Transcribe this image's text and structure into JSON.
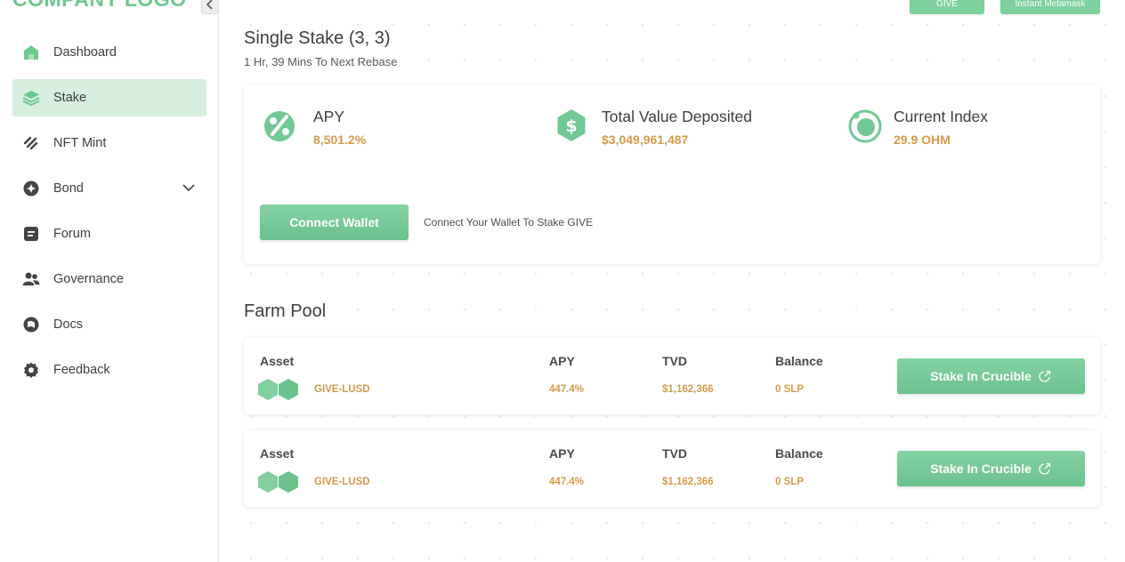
{
  "sidebar": {
    "logo": "COMPANY LOGO",
    "items": [
      {
        "label": "Dashboard",
        "icon": "home-icon"
      },
      {
        "label": "Stake",
        "icon": "layers-icon",
        "active": true
      },
      {
        "label": "NFT Mint",
        "icon": "nft-icon"
      },
      {
        "label": "Bond",
        "icon": "bond-icon",
        "has_submenu": true
      },
      {
        "label": "Forum",
        "icon": "forum-icon"
      },
      {
        "label": "Governance",
        "icon": "users-icon"
      },
      {
        "label": "Docs",
        "icon": "docs-icon"
      },
      {
        "label": "Feedback",
        "icon": "gear-icon"
      }
    ]
  },
  "header": {
    "buttons": [
      "GIVE",
      "Instant Metamask"
    ]
  },
  "single_stake": {
    "title": "Single Stake (3, 3)",
    "subtitle": "1 Hr, 39 Mins To Next Rebase",
    "stats": [
      {
        "label": "APY",
        "value": "8,501.2%",
        "icon": "percent-icon"
      },
      {
        "label": "Total Value Deposited",
        "value": "$3,049,961,487",
        "icon": "dollar-icon"
      },
      {
        "label": "Current Index",
        "value": "29.9 OHM",
        "icon": "index-icon"
      }
    ],
    "connect_button": "Connect Wallet",
    "connect_hint": "Connect Your Wallet To Stake GIVE"
  },
  "farm_pool": {
    "title": "Farm Pool",
    "headers": {
      "asset": "Asset",
      "apy": "APY",
      "tvd": "TVD",
      "balance": "Balance"
    },
    "rows": [
      {
        "asset": "GIVE-LUSD",
        "apy": "447.4%",
        "tvd": "$1,162,366",
        "balance": "0 SLP",
        "action": "Stake In Crucible"
      },
      {
        "asset": "GIVE-LUSD",
        "apy": "447.4%",
        "tvd": "$1,162,366",
        "balance": "0 SLP",
        "action": "Stake In Crucible"
      }
    ]
  },
  "colors": {
    "accent": "#72c894",
    "accent_light": "#d6efdf",
    "value_orange": "#d59a4a"
  }
}
